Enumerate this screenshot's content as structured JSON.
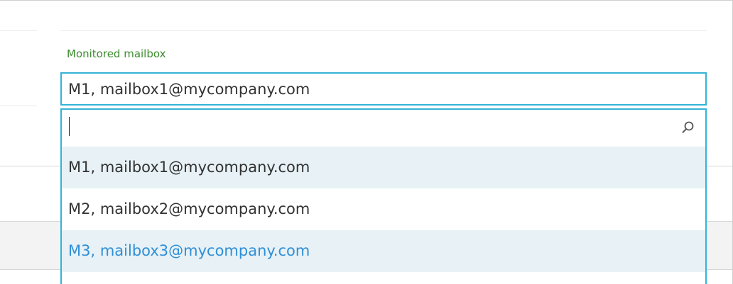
{
  "field": {
    "label": "Monitored mailbox",
    "selected_value": "M1, mailbox1@mycompany.com"
  },
  "dropdown": {
    "search": {
      "value": "",
      "placeholder": ""
    },
    "options": [
      {
        "label": "M1, mailbox1@mycompany.com",
        "state": "selected"
      },
      {
        "label": "M2, mailbox2@mycompany.com",
        "state": "normal"
      },
      {
        "label": "M3, mailbox3@mycompany.com",
        "state": "hover"
      }
    ]
  },
  "colors": {
    "accent_border": "#33b3d8",
    "label_green": "#3c8d2f",
    "option_highlight_bg": "#e7f1f6",
    "option_hover_text": "#2f8fd6"
  }
}
